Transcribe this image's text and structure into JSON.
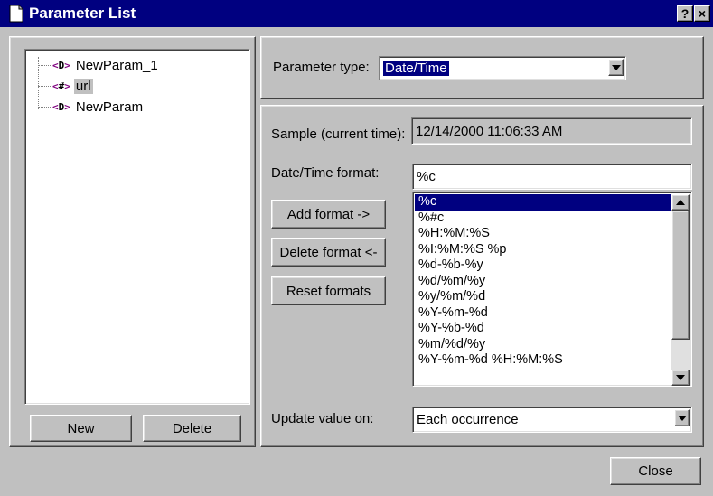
{
  "window": {
    "title": "Parameter List",
    "help_label": "?",
    "close_label": "×"
  },
  "tree": {
    "items": [
      {
        "tag_open": "<",
        "tag_symbol": "D",
        "tag_close": ">",
        "label": "NewParam_1",
        "selected": false
      },
      {
        "tag_open": "<",
        "tag_symbol": "#",
        "tag_close": ">",
        "label": "url",
        "selected": true
      },
      {
        "tag_open": "<",
        "tag_symbol": "D",
        "tag_close": ">",
        "label": "NewParam",
        "selected": false
      }
    ]
  },
  "buttons": {
    "new_label": "New",
    "delete_label": "Delete",
    "add_format_label": "Add format ->",
    "delete_format_label": "Delete format <-",
    "reset_formats_label": "Reset formats",
    "close_label": "Close"
  },
  "param_type": {
    "label": "Parameter type:",
    "value": "Date/Time"
  },
  "sample": {
    "label": "Sample (current time):",
    "value": "12/14/2000 11:06:33 AM"
  },
  "format": {
    "label": "Date/Time format:",
    "value": "%c",
    "list": [
      "%c",
      "%#c",
      "%H:%M:%S",
      "%I:%M:%S %p",
      "%d-%b-%y",
      "%d/%m/%y",
      "%y/%m/%d",
      "%Y-%m-%d",
      "%Y-%b-%d",
      "%m/%d/%y",
      "%Y-%m-%d %H:%M:%S"
    ],
    "selected_index": 0
  },
  "update": {
    "label": "Update value on:",
    "value": "Each occurrence"
  },
  "colors": {
    "title_bar": "#000080",
    "selection": "#000080",
    "face": "#c0c0c0",
    "tag_color": "#800080"
  }
}
